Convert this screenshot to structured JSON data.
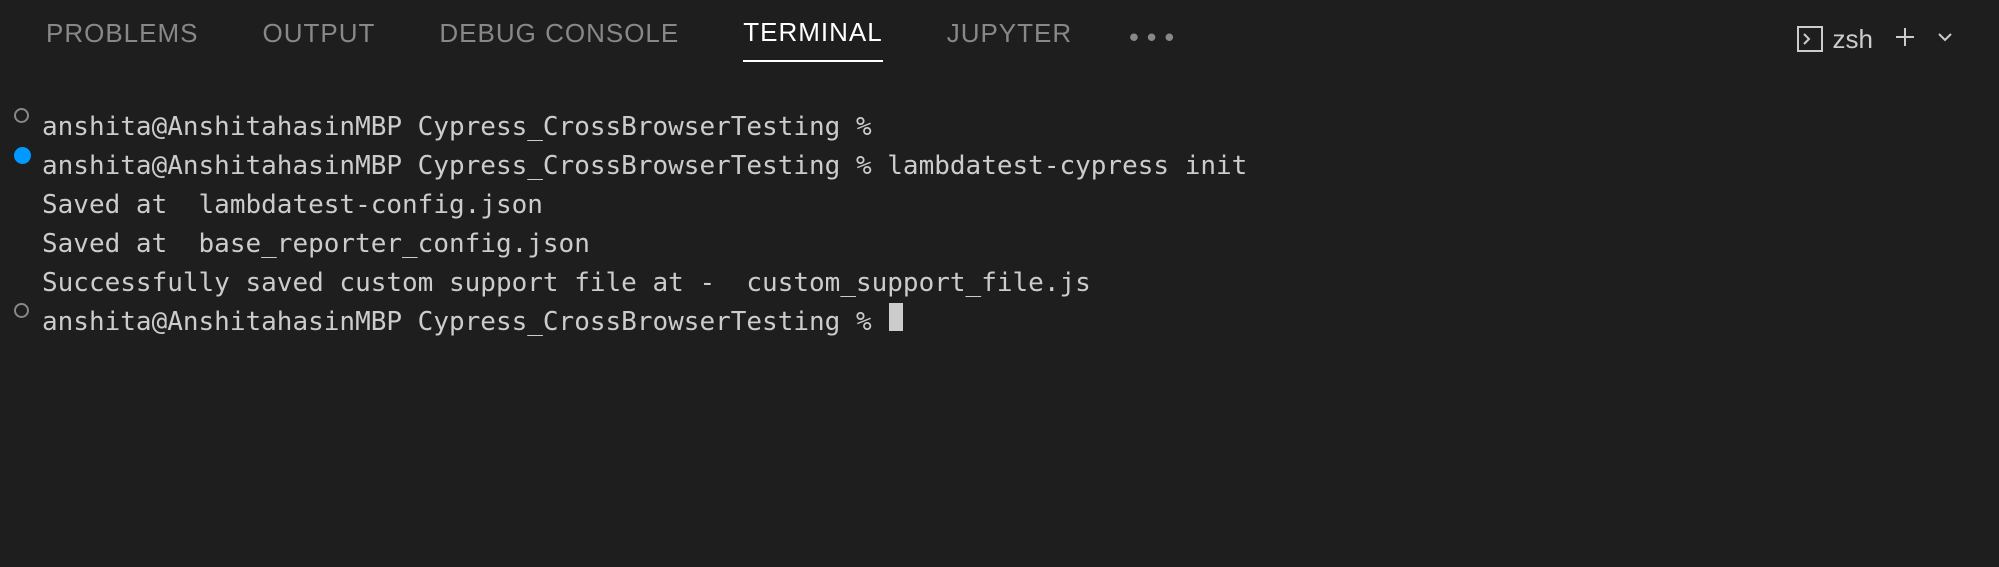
{
  "tabs": {
    "problems": "PROBLEMS",
    "output": "OUTPUT",
    "debug_console": "DEBUG CONSOLE",
    "terminal": "TERMINAL",
    "jupyter": "JUPYTER"
  },
  "shell": {
    "label": "zsh"
  },
  "terminal": {
    "lines": [
      {
        "marker": "outline",
        "text": "anshita@AnshitahasinMBP Cypress_CrossBrowserTesting %"
      },
      {
        "marker": "filled",
        "text": "anshita@AnshitahasinMBP Cypress_CrossBrowserTesting % lambdatest-cypress init"
      },
      {
        "marker": "none",
        "text": "Saved at  lambdatest-config.json"
      },
      {
        "marker": "none",
        "text": "Saved at  base_reporter_config.json"
      },
      {
        "marker": "none",
        "text": "Successfully saved custom support file at -  custom_support_file.js"
      },
      {
        "marker": "outline",
        "text": "anshita@AnshitahasinMBP Cypress_CrossBrowserTesting % ",
        "cursor": true
      }
    ]
  }
}
